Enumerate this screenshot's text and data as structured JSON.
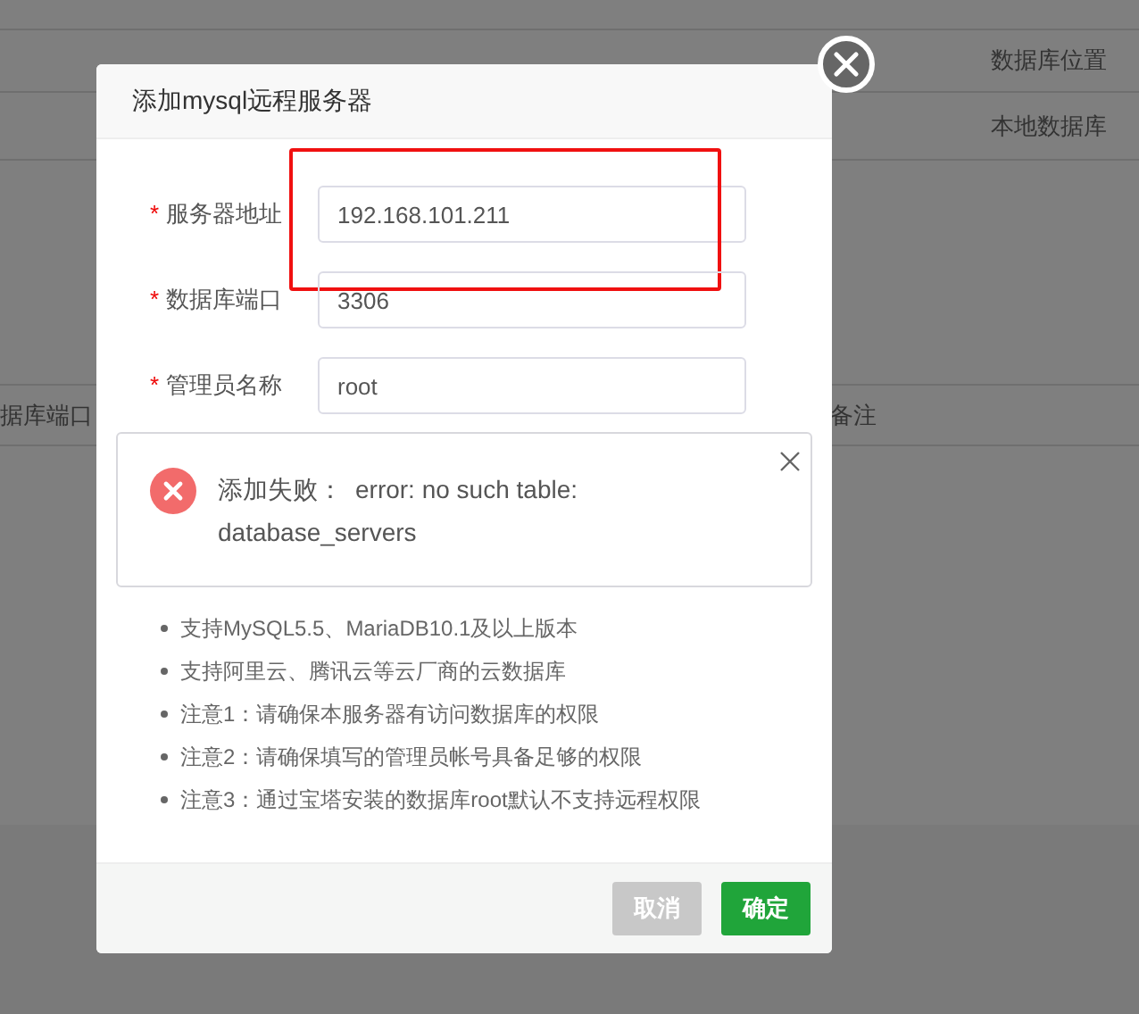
{
  "background": {
    "header_cells": [
      "数据库位置"
    ],
    "row_cells": [
      "本地数据库"
    ],
    "second_header_cells": [
      "据库端口",
      "备注"
    ]
  },
  "dialog": {
    "title": "添加mysql远程服务器",
    "fields": [
      {
        "label": "服务器地址",
        "required_mark": "*",
        "value": "192.168.101.211"
      },
      {
        "label": "数据库端口",
        "required_mark": "*",
        "value": "3306"
      },
      {
        "label": "管理员名称",
        "required_mark": "*",
        "value": "root"
      }
    ],
    "highlight_box": true,
    "error": {
      "prefix": "添加失败：",
      "message": "error: no such table: database_servers"
    },
    "notes": [
      "支持MySQL5.5、MariaDB10.1及以上版本",
      "支持阿里云、腾讯云等云厂商的云数据库",
      "注意1：请确保本服务器有访问数据库的权限",
      "注意2：请确保填写的管理员帐号具备足够的权限",
      "注意3：通过宝塔安装的数据库root默认不支持远程权限"
    ],
    "buttons": [
      {
        "label": "取消",
        "kind": "cancel"
      },
      {
        "label": "确定",
        "kind": "confirm"
      }
    ]
  }
}
